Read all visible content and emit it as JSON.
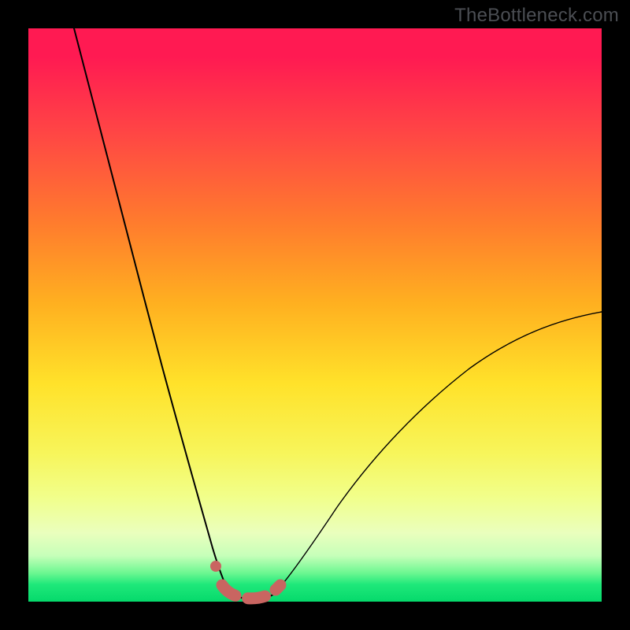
{
  "watermark": "TheBottleneck.com",
  "colors": {
    "frame": "#000000",
    "gradient_top": "#ff1a52",
    "gradient_bottom": "#05d96b",
    "curve": "#000000",
    "beads": "#c96561"
  },
  "chart_data": {
    "type": "line",
    "title": "",
    "xlabel": "",
    "ylabel": "",
    "xlim": [
      0,
      100
    ],
    "ylim": [
      0,
      100
    ],
    "grid": false,
    "legend": false,
    "annotations": [
      "TheBottleneck.com"
    ],
    "series": [
      {
        "name": "left-curve",
        "x": [
          8,
          12,
          16,
          20,
          23,
          25,
          27,
          29,
          30.5,
          31.5,
          32.3,
          33,
          33.6,
          34.1
        ],
        "y": [
          100,
          81,
          63,
          46,
          33,
          25,
          18,
          12,
          8,
          5.5,
          3.8,
          2.6,
          1.8,
          1.2
        ]
      },
      {
        "name": "valley-floor",
        "x": [
          34.1,
          35,
          36,
          37,
          38,
          39,
          40,
          41
        ],
        "y": [
          1.2,
          0.8,
          0.55,
          0.45,
          0.45,
          0.5,
          0.7,
          1.1
        ]
      },
      {
        "name": "right-curve",
        "x": [
          41,
          44,
          48,
          53,
          59,
          66,
          74,
          82,
          90,
          98,
          100
        ],
        "y": [
          1.1,
          3,
          7.5,
          14,
          21.5,
          29,
          36,
          41.5,
          46,
          49.5,
          50.5
        ]
      },
      {
        "name": "bead-markers",
        "x": [
          32.5,
          34,
          36,
          38,
          40,
          41.5
        ],
        "y": [
          5,
          1.2,
          0.55,
          0.45,
          0.7,
          1.4
        ]
      }
    ]
  }
}
